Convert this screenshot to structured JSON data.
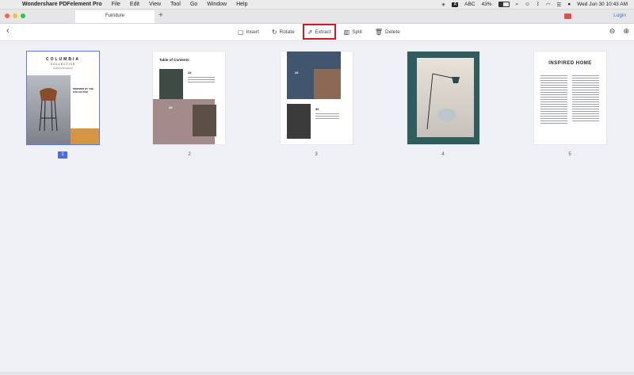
{
  "menubar": {
    "app_name": "Wondershare PDFelement Pro",
    "menus": [
      "File",
      "Edit",
      "View",
      "Tool",
      "Go",
      "Window",
      "Help"
    ],
    "input_source": "A",
    "input_label": "ABC",
    "battery_percent": "43%",
    "battery_level": 0.43,
    "datetime": "Wed Jun 30  10:43 AM"
  },
  "tabbar": {
    "doc_tab": "Furniture",
    "new_tab": "+",
    "login": "Login"
  },
  "toolbar": {
    "insert": "Insert",
    "rotate": "Rotate",
    "extract": "Extract",
    "split": "Split",
    "delete": "Delete"
  },
  "pages": [
    {
      "num": "1",
      "selected": true
    },
    {
      "num": "2",
      "selected": false
    },
    {
      "num": "3",
      "selected": false
    },
    {
      "num": "4",
      "selected": false
    },
    {
      "num": "5",
      "selected": false
    }
  ],
  "page1": {
    "title": "COLUMBIA",
    "subtitle": "COLLECTIVE",
    "tag": "FURNITURE DESIGN",
    "text": "INSPIRED BY THE COLLECTIVE"
  },
  "page2": {
    "title": "Table of Contents",
    "n1": "24",
    "n2": "28"
  },
  "page3": {
    "n1": "26",
    "n2": "30"
  },
  "page5": {
    "title": "INSPIRED HOME"
  },
  "colors": {
    "accent": "#4a6ee0",
    "highlight": "#d0182c",
    "link": "#3a6fd8"
  }
}
